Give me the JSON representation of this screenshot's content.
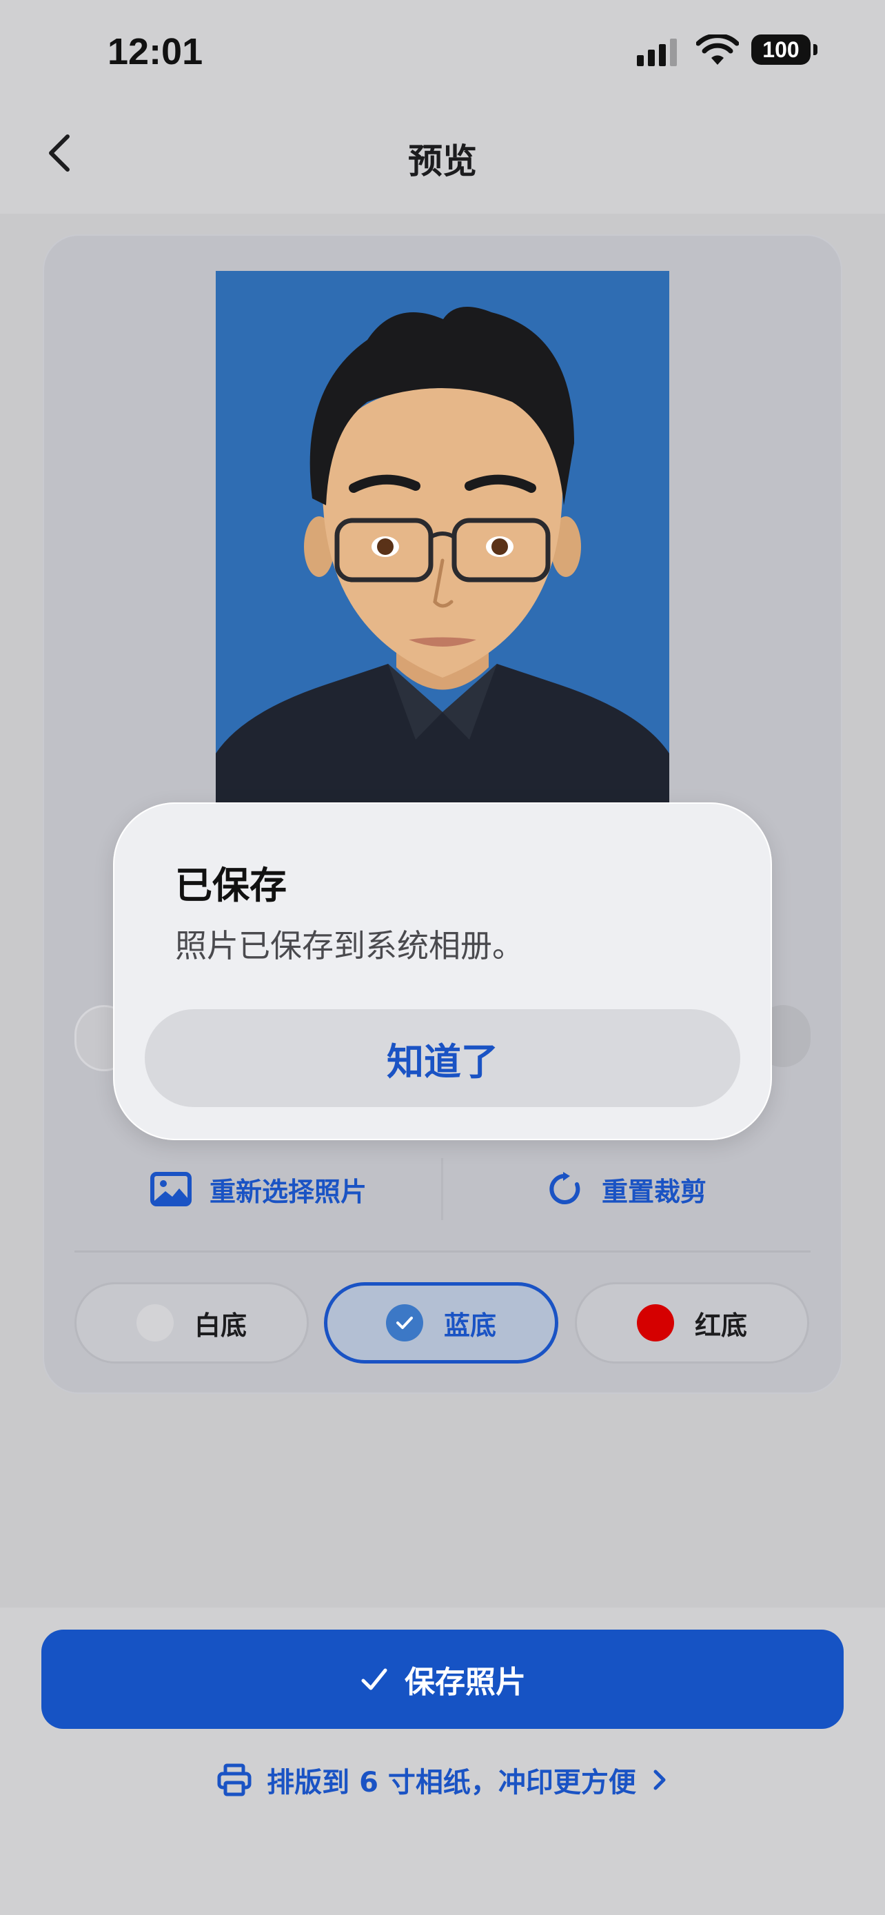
{
  "status_bar": {
    "time": "12:01",
    "battery": "100"
  },
  "nav": {
    "title": "预览",
    "back_icon": "chevron-left-icon"
  },
  "actions": {
    "reselect": "重新选择照片",
    "reset_crop": "重置裁剪"
  },
  "background_options": [
    {
      "label": "白底",
      "color": "#d3d3d6",
      "selected": false
    },
    {
      "label": "蓝底",
      "color": "#3c78c6",
      "selected": true
    },
    {
      "label": "红底",
      "color": "#d50000",
      "selected": false
    }
  ],
  "alert": {
    "title": "已保存",
    "message": "照片已保存到系统相册。",
    "button": "知道了"
  },
  "bottom": {
    "save_label": "保存照片",
    "print_link": "排版到 6 寸相纸，冲印更方便"
  },
  "colors": {
    "accent": "#1653c4",
    "photo_background": "#2f6db3"
  }
}
